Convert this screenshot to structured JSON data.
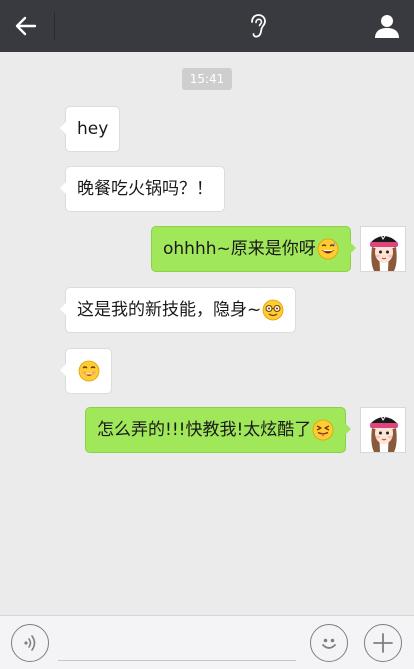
{
  "header": {
    "back_icon": "arrow-left-icon",
    "mode_icon": "ear-icon",
    "profile_icon": "person-icon",
    "background_color": "#393a3f"
  },
  "chat": {
    "timestamp": "15:41",
    "messages": [
      {
        "side": "left",
        "text": "hey"
      },
      {
        "side": "left",
        "text": "晚餐吃火锅吗？！"
      },
      {
        "side": "right",
        "text": "ohhhh~原来是你呀",
        "emoji": "grinning-sweat-emoji"
      },
      {
        "side": "left",
        "text": "这是我的新技能，隐身~",
        "emoji": "nerd-face-emoji"
      },
      {
        "side": "left",
        "text": "",
        "emoji": "smiling-emoji"
      },
      {
        "side": "right",
        "text": "怎么弄的!!!快教我!太炫酷了",
        "emoji": "tongue-out-emoji"
      }
    ],
    "outgoing_bubble_color": "#a0e75a",
    "incoming_bubble_color": "#ffffff",
    "background_color": "#ebebeb"
  },
  "footer": {
    "voice_icon": "voice-icon",
    "emoji_icon": "smiley-face-icon",
    "plus_icon": "plus-icon",
    "input_value": ""
  }
}
